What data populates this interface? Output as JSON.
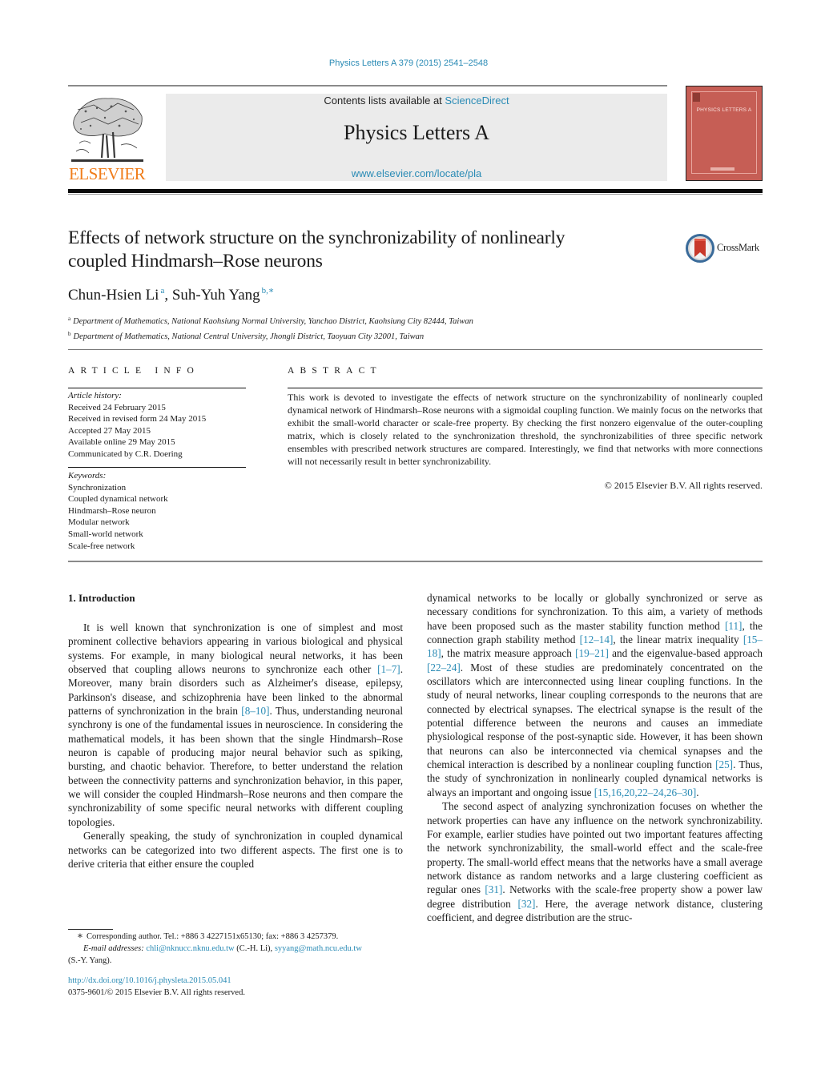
{
  "header": {
    "journal_reference": "Physics Letters A 379 (2015) 2541–2548",
    "contents_prefix": "Contents lists available at ",
    "contents_link": "ScienceDirect",
    "journal_title": "Physics Letters A",
    "journal_url": "www.elsevier.com/locate/pla",
    "publisher_logo_text": "ELSEVIER",
    "cover_title": "PHYSICS LETTERS A",
    "crossmark_label": "CrossMark"
  },
  "article": {
    "title_line1": "Effects of network structure on the synchronizability of nonlinearly",
    "title_line2": "coupled Hindmarsh–Rose neurons",
    "authors": [
      {
        "name": "Chun-Hsien Li",
        "marks": "a"
      },
      {
        "name": "Suh-Yuh Yang",
        "marks": "b,∗"
      }
    ],
    "author_separator": ", ",
    "affiliations": [
      {
        "mark": "a",
        "text": "Department of Mathematics, National Kaohsiung Normal University, Yanchao District, Kaohsiung City 82444, Taiwan"
      },
      {
        "mark": "b",
        "text": "Department of Mathematics, National Central University, Jhongli District, Taoyuan City 32001, Taiwan"
      }
    ]
  },
  "article_info": {
    "heading": "ARTICLE INFO",
    "history_label": "Article history:",
    "history": [
      "Received 24 February 2015",
      "Received in revised form 24 May 2015",
      "Accepted 27 May 2015",
      "Available online 29 May 2015",
      "Communicated by C.R. Doering"
    ],
    "keywords_label": "Keywords:",
    "keywords": [
      "Synchronization",
      "Coupled dynamical network",
      "Hindmarsh–Rose neuron",
      "Modular network",
      "Small-world network",
      "Scale-free network"
    ]
  },
  "abstract": {
    "heading": "ABSTRACT",
    "text": "This work is devoted to investigate the effects of network structure on the synchronizability of nonlinearly coupled dynamical network of Hindmarsh–Rose neurons with a sigmoidal coupling function. We mainly focus on the networks that exhibit the small-world character or scale-free property. By checking the first nonzero eigenvalue of the outer-coupling matrix, which is closely related to the synchronization threshold, the synchronizabilities of three specific network ensembles with prescribed network structures are compared. Interestingly, we find that networks with more connections will not necessarily result in better synchronizability.",
    "copyright": "© 2015 Elsevier B.V. All rights reserved."
  },
  "introduction": {
    "heading": "1. Introduction",
    "p1": [
      {
        "t": "It is well known that synchronization is one of simplest and most prominent collective behaviors appearing in various biological and physical systems. For example, in many biological neural networks, it has been observed that coupling allows neurons to synchronize each other "
      },
      {
        "ref": "[1–7]"
      },
      {
        "t": ". Moreover, many brain disorders such as Alzheimer's disease, epilepsy, Parkinson's disease, and schizophrenia have been linked to the abnormal patterns of synchronization in the brain "
      },
      {
        "ref": "[8–10]"
      },
      {
        "t": ". Thus, understanding neuronal synchrony is one of the fundamental issues in neuroscience. In considering the mathematical models, it has been shown that the single Hindmarsh–Rose neuron is capable of producing major neural behavior such as spiking, bursting, and chaotic behavior. Therefore, to better understand the relation between the connectivity patterns and synchronization behavior, in this paper, we will consider the coupled Hindmarsh–Rose neurons and then compare the synchronizability of some specific neural networks with different coupling topologies."
      }
    ],
    "p2": [
      {
        "t": "Generally speaking, the study of synchronization in coupled dynamical networks can be categorized into two different aspects. The first one is to derive criteria that either ensure the coupled dynamical networks to be locally or globally synchronized or serve as necessary conditions for synchronization. To this aim, a variety of methods have been proposed such as the master stability function method "
      },
      {
        "ref": "[11]"
      },
      {
        "t": ", the connection graph stability method "
      },
      {
        "ref": "[12–14]"
      },
      {
        "t": ", the linear matrix inequality "
      },
      {
        "ref": "[15–18]"
      },
      {
        "t": ", the matrix measure approach "
      },
      {
        "ref": "[19–21]"
      },
      {
        "t": " and the eigenvalue-based approach "
      },
      {
        "ref": "[22–24]"
      },
      {
        "t": ". Most of these studies are predominately concentrated on the oscillators which are interconnected using linear coupling functions. In the study of neural networks, linear coupling corresponds to the neurons that are connected by electrical synapses. The electrical synapse is the result of the potential difference between the neurons and causes an immediate physiological response of the post-synaptic side. However, it has been shown that neurons can also be interconnected via chemical synapses and the chemical interaction is described by a nonlinear coupling function "
      },
      {
        "ref": "[25]"
      },
      {
        "t": ". Thus, the study of synchronization in nonlinearly coupled dynamical networks is always an important and ongoing issue "
      },
      {
        "ref": "[15,16,20,22–24,26–30]"
      },
      {
        "t": "."
      }
    ],
    "p3": [
      {
        "t": "The second aspect of analyzing synchronization focuses on whether the network properties can have any influence on the network synchronizability. For example, earlier studies have pointed out two important features affecting the network synchronizability, the small-world effect and the scale-free property. The small-world effect means that the networks have a small average network distance as random networks and a large clustering coefficient as regular ones "
      },
      {
        "ref": "[31]"
      },
      {
        "t": ". Networks with the scale-free property show a power law degree distribution "
      },
      {
        "ref": "[32]"
      },
      {
        "t": ". Here, the average network distance, clustering coefficient, and degree distribution are the struc-"
      }
    ]
  },
  "footnote": {
    "star": "∗",
    "corresponding": "Corresponding author. Tel.: +886 3 4227151x65130; fax: +886 3 4257379.",
    "email_label": "E-mail addresses: ",
    "email1": "chli@nknucc.nknu.edu.tw",
    "email1_owner": " (C.-H. Li), ",
    "email2": "syyang@math.ncu.edu.tw",
    "email2_owner": "(S.-Y. Yang)."
  },
  "doi": {
    "link": "http://dx.doi.org/10.1016/j.physleta.2015.05.041",
    "issn_line": "0375-9601/© 2015 Elsevier B.V. All rights reserved."
  }
}
